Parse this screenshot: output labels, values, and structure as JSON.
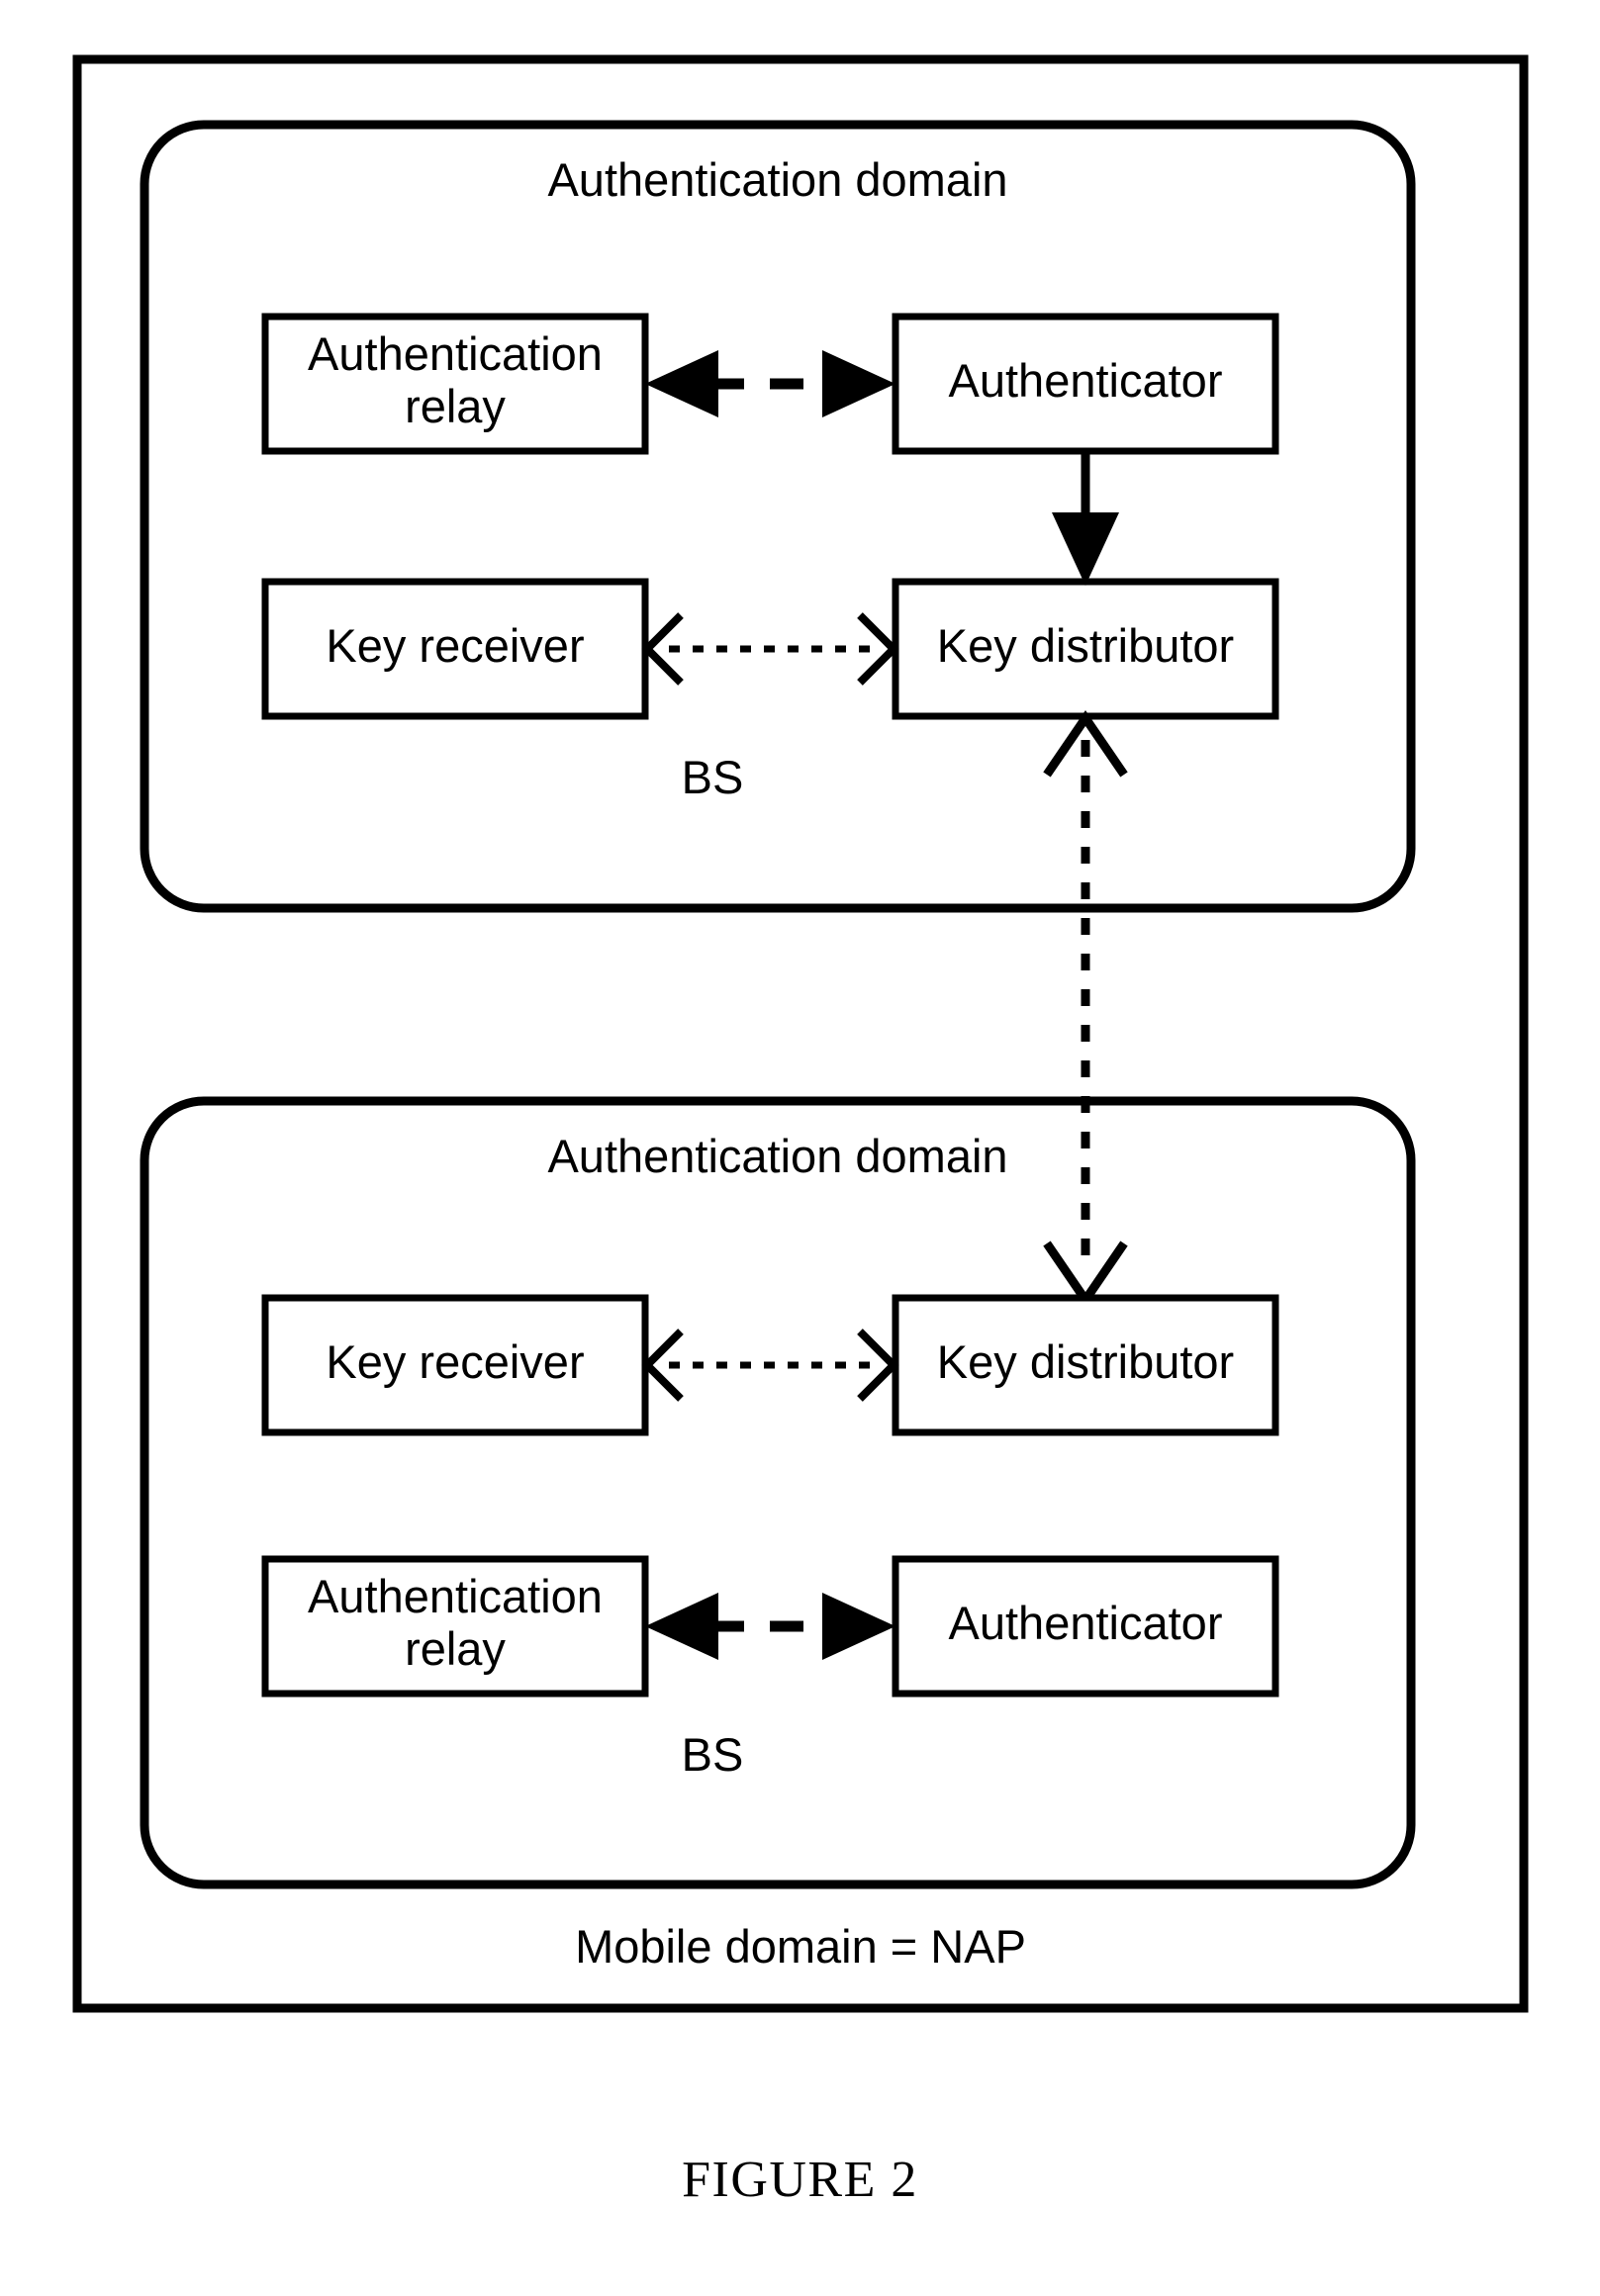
{
  "figure": {
    "caption": "FIGURE 2",
    "outer_label": "Mobile domain = NAP",
    "stroke_color": "#000000",
    "background_color": "#ffffff"
  },
  "panels": [
    {
      "id": "upper-authentication-domain",
      "title": "Authentication domain",
      "footer_label": "BS",
      "nodes": [
        {
          "id": "upper-authentication-relay",
          "label": "Authentication\nrelay"
        },
        {
          "id": "upper-authenticator",
          "label": "Authenticator"
        },
        {
          "id": "upper-key-receiver",
          "label": "Key receiver"
        },
        {
          "id": "upper-key-distributor",
          "label": "Key distributor"
        }
      ]
    },
    {
      "id": "lower-authentication-domain",
      "title": "Authentication domain",
      "footer_label": "BS",
      "nodes": [
        {
          "id": "lower-key-receiver",
          "label": "Key receiver"
        },
        {
          "id": "lower-key-distributor",
          "label": "Key distributor"
        },
        {
          "id": "lower-authentication-relay",
          "label": "Authentication\nrelay"
        },
        {
          "id": "lower-authenticator",
          "label": "Authenticator"
        }
      ]
    }
  ],
  "connections": [
    {
      "id": "upper-relay-authenticator-link",
      "from": "upper-authentication-relay",
      "to": "upper-authenticator",
      "style": "dashed",
      "direction": "bidirectional",
      "arrowhead": "filled"
    },
    {
      "id": "upper-authenticator-distributor-link",
      "from": "upper-authenticator",
      "to": "upper-key-distributor",
      "style": "solid",
      "direction": "downward",
      "arrowhead": "filled"
    },
    {
      "id": "upper-receiver-distributor-link",
      "from": "upper-key-receiver",
      "to": "upper-key-distributor",
      "style": "dotted",
      "direction": "bidirectional",
      "arrowhead": "open"
    },
    {
      "id": "interdomain-key-distributor-link",
      "from": "upper-key-distributor",
      "to": "lower-key-distributor",
      "style": "dotted",
      "direction": "bidirectional",
      "arrowhead": "open"
    },
    {
      "id": "lower-receiver-distributor-link",
      "from": "lower-key-receiver",
      "to": "lower-key-distributor",
      "style": "dotted",
      "direction": "bidirectional",
      "arrowhead": "open"
    },
    {
      "id": "lower-relay-authenticator-link",
      "from": "lower-authentication-relay",
      "to": "lower-authenticator",
      "style": "dashed",
      "direction": "bidirectional",
      "arrowhead": "filled"
    }
  ]
}
